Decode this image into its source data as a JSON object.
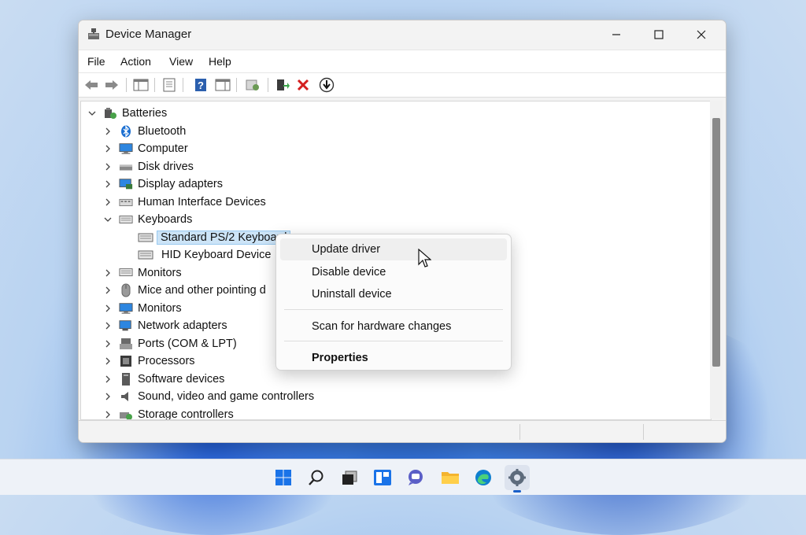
{
  "window": {
    "title": "Device Manager",
    "controls": {
      "minimize": "—",
      "maximize": "☐",
      "close": "✕"
    }
  },
  "menu": {
    "items": [
      "File",
      "Action",
      "View",
      "Help"
    ]
  },
  "toolbar": {
    "buttons": [
      "back-arrow-icon",
      "forward-arrow-icon",
      "console-tree-icon",
      "properties-sheet-icon",
      "help-icon",
      "show-action-pane-icon",
      "scan-hardware-icon",
      "update-driver-icon",
      "uninstall-icon",
      "enable-device-icon"
    ]
  },
  "tree": {
    "root": {
      "label": "Batteries",
      "expanded": true
    },
    "categories": [
      {
        "label": "Bluetooth",
        "icon": "bluetooth-icon",
        "expanded": false
      },
      {
        "label": "Computer",
        "icon": "computer-icon",
        "expanded": false
      },
      {
        "label": "Disk drives",
        "icon": "disk-drive-icon",
        "expanded": false
      },
      {
        "label": "Display adapters",
        "icon": "display-adapter-icon",
        "expanded": false
      },
      {
        "label": "Human Interface Devices",
        "icon": "hid-icon",
        "expanded": false
      },
      {
        "label": "Keyboards",
        "icon": "keyboard-icon",
        "expanded": true
      }
    ],
    "keyboard_children": [
      {
        "label": "Standard PS/2 Keyboard",
        "selected": true
      },
      {
        "label": "HID Keyboard Device",
        "selected": false
      }
    ],
    "categories_after": [
      {
        "label": "Monitors",
        "icon": "monitor-icon"
      },
      {
        "label": "Mice and other pointing d",
        "icon": "mouse-icon"
      },
      {
        "label": "Monitors",
        "icon": "monitor-icon"
      },
      {
        "label": "Network adapters",
        "icon": "network-adapter-icon"
      },
      {
        "label": "Ports (COM & LPT)",
        "icon": "port-icon"
      },
      {
        "label": "Processors",
        "icon": "processor-icon"
      },
      {
        "label": "Software devices",
        "icon": "software-device-icon"
      },
      {
        "label": "Sound, video and game controllers",
        "icon": "speaker-icon"
      },
      {
        "label": "Storage controllers",
        "icon": "storage-controller-icon"
      }
    ]
  },
  "context_menu": {
    "items": [
      "Update driver",
      "Disable device",
      "Uninstall device",
      "Scan for hardware changes",
      "Properties"
    ],
    "hovered": "Update driver"
  },
  "taskbar": {
    "icons": [
      "windows-start-icon",
      "search-icon",
      "task-view-icon",
      "widgets-icon",
      "chat-icon",
      "file-explorer-icon",
      "edge-browser-icon",
      "settings-gear-icon"
    ],
    "active": "settings-gear-icon"
  },
  "colors": {
    "accent": "#1a5fc8",
    "selection": "#cce4f7",
    "wallpaper": "#3f7fe0"
  }
}
